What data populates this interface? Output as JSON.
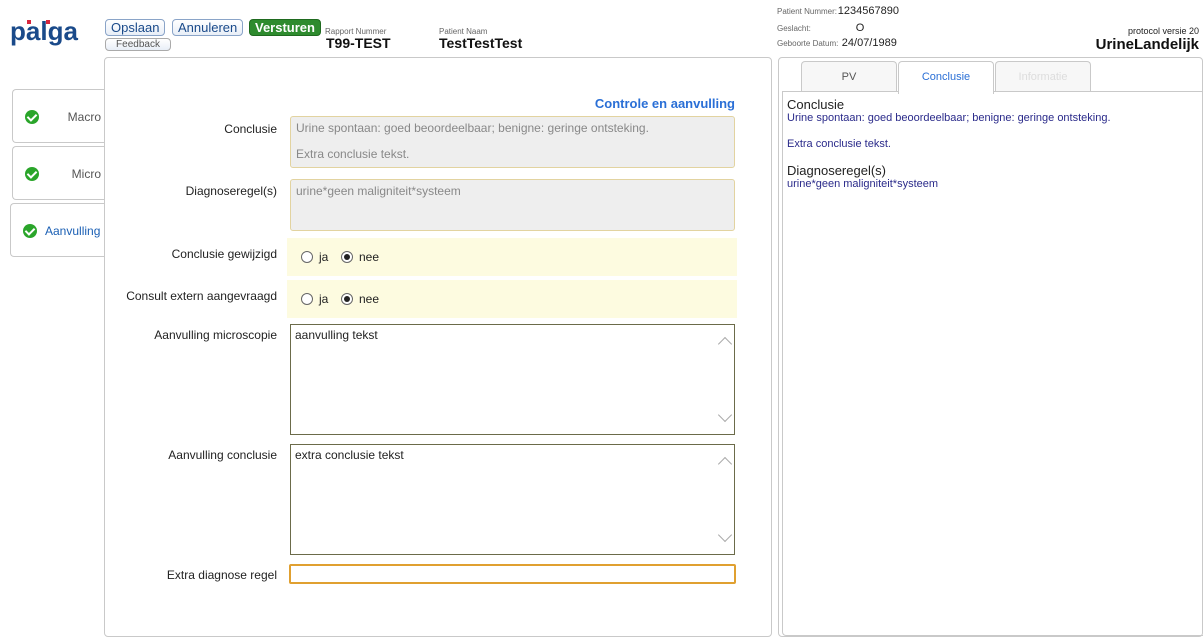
{
  "header": {
    "logo_text": "palga",
    "buttons": {
      "save": "Opslaan",
      "cancel": "Annuleren",
      "send": "Versturen",
      "feedback": "Feedback"
    },
    "report_number_label": "Rapport Nummer",
    "report_number": "T99-TEST",
    "patient_name_label": "Patient Naam",
    "patient_name": "TestTestTest"
  },
  "patient_info": {
    "number_label": "Patient Nummer:",
    "number": "1234567890",
    "gender_label": "Geslacht:",
    "gender": "O",
    "birthdate_label": "Geboorte Datum:",
    "birthdate": "24/07/1989",
    "protocol_version": "protocol versie 20",
    "protocol_name": "UrineLandelijk"
  },
  "left_tabs": [
    {
      "label": "Macro"
    },
    {
      "label": "Micro"
    },
    {
      "label": "Aanvulling"
    }
  ],
  "form": {
    "title": "Controle en aanvulling",
    "conclusie_label": "Conclusie",
    "conclusie_lines": [
      "Urine spontaan: goed beoordeelbaar; benigne: geringe ontsteking.",
      "Extra conclusie tekst."
    ],
    "diagnoseregel_label": "Diagnoseregel(s)",
    "diagnoseregel_value": "urine*geen maligniteit*systeem",
    "conclusie_gewijzigd_label": "Conclusie gewijzigd",
    "consult_extern_label": "Consult extern aangevraagd",
    "radio_yes": "ja",
    "radio_no": "nee",
    "aanvulling_microscopie_label": "Aanvulling microscopie",
    "aanvulling_microscopie_value": "aanvulling tekst",
    "aanvulling_conclusie_label": "Aanvulling conclusie",
    "aanvulling_conclusie_value": "extra conclusie tekst",
    "extra_diagnose_label": "Extra diagnose regel",
    "extra_diagnose_value": ""
  },
  "right_panel": {
    "tabs": [
      "PV",
      "Conclusie",
      "Informatie"
    ],
    "conclusie_title": "Conclusie",
    "conclusie_text_1": "Urine spontaan: goed beoordeelbaar; benigne: geringe ontsteking.",
    "conclusie_text_2": "Extra conclusie tekst.",
    "diagnose_title": "Diagnoseregel(s)",
    "diagnose_text": "urine*geen maligniteit*systeem"
  },
  "colors": {
    "brand_red": "#d7263d",
    "brand_blue": "#1a4a8a",
    "accent_blue": "#2a6fd6",
    "check_green": "#2aa52a"
  }
}
